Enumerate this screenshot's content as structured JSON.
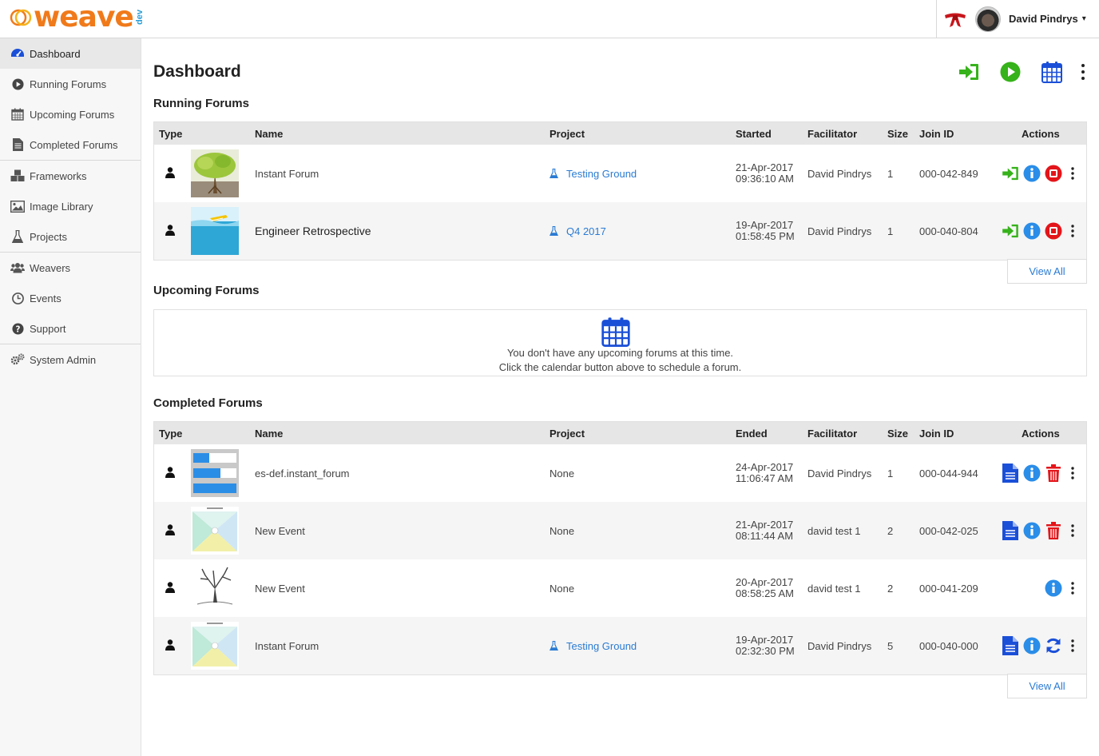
{
  "app": {
    "logo_text": "weave",
    "logo_badge": "dev",
    "user_name": "David Pindrys",
    "user_menu_caret": "▾"
  },
  "sidebar": {
    "items": [
      {
        "label": "Dashboard",
        "icon": "dashboard-icon",
        "active": true
      },
      {
        "label": "Running Forums",
        "icon": "play-circle-icon"
      },
      {
        "label": "Upcoming Forums",
        "icon": "calendar-icon"
      },
      {
        "label": "Completed Forums",
        "icon": "document-icon"
      },
      {
        "label": "Frameworks",
        "icon": "cubes-icon"
      },
      {
        "label": "Image Library",
        "icon": "image-icon"
      },
      {
        "label": "Projects",
        "icon": "flask-icon"
      },
      {
        "label": "Weavers",
        "icon": "users-icon"
      },
      {
        "label": "Events",
        "icon": "clock-icon"
      },
      {
        "label": "Support",
        "icon": "question-circle-icon"
      },
      {
        "label": "System Admin",
        "icon": "gears-icon"
      }
    ]
  },
  "main": {
    "title": "Dashboard",
    "toolbar": [
      "join-forum-icon",
      "start-forum-icon",
      "schedule-calendar-icon",
      "more-options-icon"
    ]
  },
  "running": {
    "title": "Running Forums",
    "columns": {
      "type": "Type",
      "name": "Name",
      "project": "Project",
      "started": "Started",
      "facilitator": "Facilitator",
      "size": "Size",
      "join_id": "Join ID",
      "actions": "Actions"
    },
    "rows": [
      {
        "name": "Instant Forum",
        "project": "Testing Ground",
        "date": "21-Apr-2017",
        "time": "09:36:10 AM",
        "facilitator": "David Pindrys",
        "size": "1",
        "join_id": "000-042-849",
        "thumb": "tree"
      },
      {
        "name": "Engineer Retrospective",
        "project": "Q4 2017",
        "date": "19-Apr-2017",
        "time": "01:58:45 PM",
        "facilitator": "David Pindrys",
        "size": "1",
        "join_id": "000-040-804",
        "thumb": "boat"
      }
    ],
    "view_all": "View All"
  },
  "upcoming": {
    "title": "Upcoming Forums",
    "empty_line1": "You don't have any upcoming forums at this time.",
    "empty_line2": "Click the calendar button above to schedule a forum."
  },
  "completed": {
    "title": "Completed Forums",
    "columns": {
      "type": "Type",
      "name": "Name",
      "project": "Project",
      "ended": "Ended",
      "facilitator": "Facilitator",
      "size": "Size",
      "join_id": "Join ID",
      "actions": "Actions"
    },
    "rows": [
      {
        "name": "es-def.instant_forum",
        "project": "None",
        "date": "24-Apr-2017",
        "time": "11:06:47 AM",
        "facilitator": "David Pindrys",
        "size": "1",
        "join_id": "000-044-944"
      },
      {
        "name": "New Event",
        "project": "None",
        "date": "21-Apr-2017",
        "time": "08:11:44 AM",
        "facilitator": "david test 1",
        "size": "2",
        "join_id": "000-042-025"
      },
      {
        "name": "New Event",
        "project": "None",
        "date": "20-Apr-2017",
        "time": "08:58:25 AM",
        "facilitator": "david test 1",
        "size": "2",
        "join_id": "000-041-209"
      },
      {
        "name": "Instant Forum",
        "project": "Testing Ground",
        "date": "19-Apr-2017",
        "time": "02:32:30 PM",
        "facilitator": "David Pindrys",
        "size": "5",
        "join_id": "000-040-000"
      }
    ],
    "view_all": "View All"
  },
  "colors": {
    "green": "#36b21a",
    "blue": "#1a4fd8",
    "info_blue": "#2a8de8",
    "red": "#e3151a",
    "link": "#2a7bd3",
    "logo_orange": "#f07a1a"
  }
}
